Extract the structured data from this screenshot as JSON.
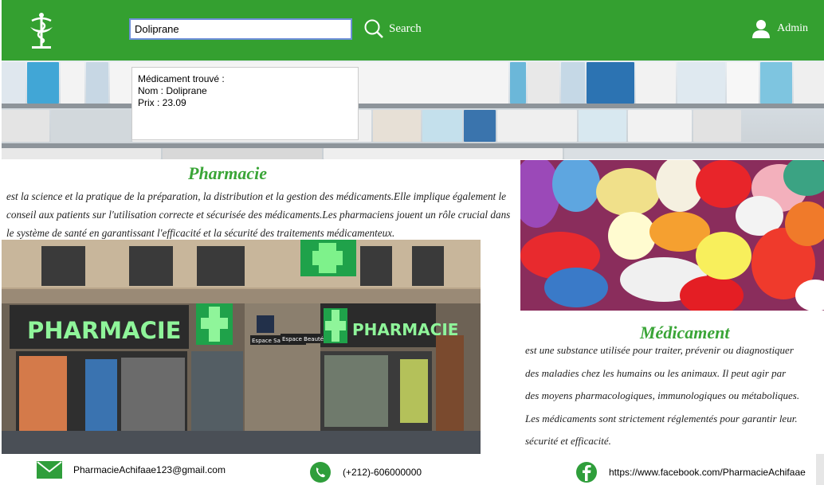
{
  "header": {
    "search_value": "Doliprane",
    "search_label": "Search",
    "admin_label": "Admin",
    "bg_color": "#34a030"
  },
  "result": {
    "title": "Médicament trouvé :",
    "name_line": "Nom : Doliprane",
    "price_line": "Prix : 23.09"
  },
  "pharmacie": {
    "title": "Pharmacie",
    "text": "est la science et la pratique de la préparation, la distribution et la gestion des médicaments.Elle implique également le conseil aux patients sur l'utilisation correcte et sécurisée des médicaments.Les pharmaciens jouent un rôle crucial dans le système de santé en garantissant l'efficacité et la sécurité des traitements médicamenteux."
  },
  "store": {
    "sign_left": "PHARMACIE",
    "sign_right": "PHARMACIE",
    "sign_small_1": "Espace Santé",
    "sign_small_2": "Espace Beauté"
  },
  "medicament": {
    "title": "Médicament",
    "lines": [
      "est une substance utilisée pour traiter, prévenir ou diagnostiquer",
      "des maladies chez les humains ou les animaux. Il peut agir par",
      "des moyens pharmacologiques, immunologiques ou métaboliques.",
      "Les médicaments sont strictement réglementés pour garantir leur.",
      " sécurité et efficacité."
    ]
  },
  "footer": {
    "email": "PharmacieAchifaae123@gmail.com",
    "phone": "(+212)-606000000",
    "facebook": "https://www.facebook.com/PharmacieAchifaae"
  },
  "icons": {
    "logo": "caduceus-icon",
    "search": "search-icon",
    "admin": "user-icon",
    "email": "mail-icon",
    "phone": "whatsapp-icon",
    "facebook": "facebook-icon"
  },
  "colors": {
    "accent_green": "#3aa537",
    "whatsapp": "#2f9e3b",
    "facebook": "#2f9e3b"
  }
}
